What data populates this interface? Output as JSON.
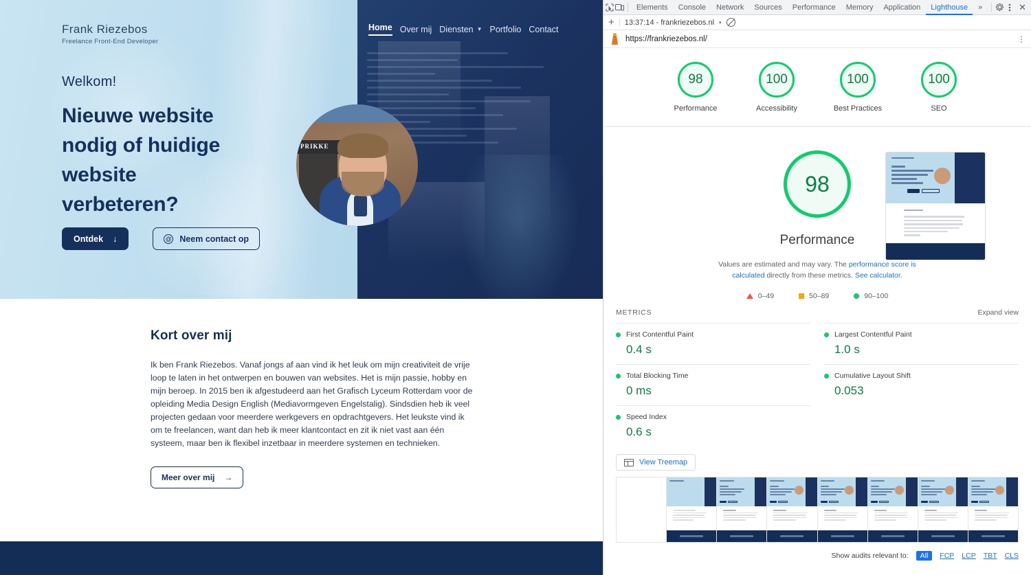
{
  "site": {
    "logo": {
      "name": "Frank Riezebos",
      "subtitle": "Freelance Front-End Developer"
    },
    "nav": [
      {
        "label": "Home",
        "active": true
      },
      {
        "label": "Over mij",
        "active": false
      },
      {
        "label": "Diensten",
        "active": false,
        "has_dropdown": true
      },
      {
        "label": "Portfolio",
        "active": false
      },
      {
        "label": "Contact",
        "active": false
      }
    ],
    "hero": {
      "eyebrow": "Welkom!",
      "heading_lines": [
        "Nieuwe website",
        "nodig of huidige",
        "website",
        "verbeteren?"
      ],
      "primary_button": "Ontdek",
      "primary_button_icon": "arrow-down-icon",
      "secondary_button": "Neem contact op",
      "secondary_button_icon": "at-sign-icon"
    },
    "about": {
      "heading": "Kort over mij",
      "paragraph": "Ik ben Frank Riezebos. Vanaf jongs af aan vind ik het leuk om mijn creativiteit de vrije loop te laten in het ontwerpen en bouwen van websites. Het is mijn passie, hobby en mijn beroep. In 2015 ben ik afgestudeerd aan het Grafisch Lyceum Rotterdam voor de opleiding Media Design English (Mediavormgeven Engelstalig). Sindsdien heb ik veel projecten gedaan voor meerdere werkgevers en opdrachtgevers. Het leukste vind ik om te freelancen, want dan heb ik meer klantcontact en zit ik niet vast aan één systeem, maar ben ik flexibel inzetbaar in meerdere systemen en technieken.",
      "button": "Meer over mij",
      "button_icon": "arrow-right-icon"
    },
    "portrait_sign_text": "PRIKKE"
  },
  "devtools": {
    "tabs": [
      {
        "label": "Elements",
        "selected": false
      },
      {
        "label": "Console",
        "selected": false
      },
      {
        "label": "Network",
        "selected": false
      },
      {
        "label": "Sources",
        "selected": false
      },
      {
        "label": "Performance",
        "selected": false
      },
      {
        "label": "Memory",
        "selected": false
      },
      {
        "label": "Application",
        "selected": false
      },
      {
        "label": "Lighthouse",
        "selected": true
      }
    ],
    "toolbar_icons": [
      "inspect-icon",
      "device-toolbar-icon",
      "overflow-icon",
      "gear-icon",
      "kebab-menu-icon",
      "close-icon"
    ],
    "overflow_label": "»",
    "close_label": "✕",
    "run_bar": {
      "new_report_label": "+",
      "report_name": "13:37:14 - frankriezebos.nl",
      "caret": "▾",
      "clear_icon": "clear-icon"
    },
    "url_bar": {
      "url": "https://frankriezebos.nl/",
      "icon": "lighthouse-icon",
      "menu_icon": "kebab-menu-icon"
    }
  },
  "report": {
    "category_scores": [
      {
        "label": "Performance",
        "score": "98"
      },
      {
        "label": "Accessibility",
        "score": "100"
      },
      {
        "label": "Best Practices",
        "score": "100"
      },
      {
        "label": "SEO",
        "score": "100"
      }
    ],
    "performance": {
      "score": "98",
      "title": "Performance",
      "note_part1": "Values are estimated and may vary. The ",
      "note_link1": "performance score is calculated",
      "note_part2": " directly from these metrics. ",
      "note_link2": "See calculator.",
      "legend": [
        {
          "icon": "triangle",
          "range": "0–49",
          "color": "#ff4e42"
        },
        {
          "icon": "square",
          "range": "50–89",
          "color": "#ffa400"
        },
        {
          "icon": "circle",
          "range": "90–100",
          "color": "#0cce6b"
        }
      ]
    },
    "metrics": {
      "title": "METRICS",
      "expand_label": "Expand view",
      "items": [
        {
          "name": "First Contentful Paint",
          "value": "0.4 s",
          "status": "pass"
        },
        {
          "name": "Largest Contentful Paint",
          "value": "1.0 s",
          "status": "pass"
        },
        {
          "name": "Total Blocking Time",
          "value": "0 ms",
          "status": "pass"
        },
        {
          "name": "Cumulative Layout Shift",
          "value": "0.053",
          "status": "pass"
        },
        {
          "name": "Speed Index",
          "value": "0.6 s",
          "status": "pass"
        }
      ]
    },
    "treemap_button": {
      "label": "View Treemap",
      "icon": "treemap-icon"
    },
    "filmstrip_frame_count": 8,
    "audits_filter": {
      "label": "Show audits relevant to:",
      "options": [
        {
          "label": "All",
          "selected": true
        },
        {
          "label": "FCP",
          "selected": false
        },
        {
          "label": "LCP",
          "selected": false
        },
        {
          "label": "TBT",
          "selected": false
        },
        {
          "label": "CLS",
          "selected": false
        }
      ]
    }
  },
  "colors": {
    "pass_green": "#0cce6b",
    "link_blue": "#1a73e8",
    "brand_navy": "#16305c",
    "hero_blue": "#bcdcee"
  }
}
